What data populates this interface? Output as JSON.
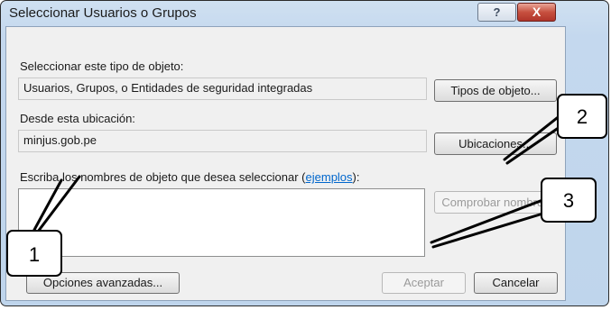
{
  "window": {
    "title": "Seleccionar Usuarios o Grupos",
    "help_label": "?",
    "close_label": "X"
  },
  "object_type": {
    "label": "Seleccionar este tipo de objeto:",
    "value": "Usuarios, Grupos, o Entidades de seguridad integradas",
    "button": "Tipos de objeto..."
  },
  "location": {
    "label": "Desde esta ubicación:",
    "value": "minjus.gob.pe",
    "button": "Ubicaciones..."
  },
  "names": {
    "label_prefix": "Escriba los nombres de objeto que desea seleccionar (",
    "link": "ejemplos",
    "label_suffix": "):",
    "value": "",
    "check_button": "Comprobar nombres"
  },
  "footer": {
    "advanced_button": "Opciones avanzadas...",
    "accept_button": "Aceptar",
    "cancel_button": "Cancelar"
  },
  "callouts": [
    "1",
    "2",
    "3"
  ]
}
